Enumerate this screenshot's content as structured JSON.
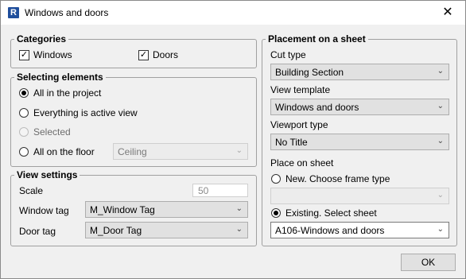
{
  "window": {
    "title": "Windows and doors",
    "close_glyph": "✕",
    "app_icon_letter": "R"
  },
  "categories": {
    "legend": "Categories",
    "windows": {
      "label": "Windows",
      "checked": true
    },
    "doors": {
      "label": "Doors",
      "checked": true
    },
    "check_glyph": "✓"
  },
  "selecting": {
    "legend": "Selecting elements",
    "all_project": "All in the project",
    "everything_view": "Everything is active view",
    "selected": "Selected",
    "all_floor": "All on the floor",
    "floor_value": "Ceiling"
  },
  "view_settings": {
    "legend": "View settings",
    "scale_label": "Scale",
    "scale_value": "50",
    "window_tag_label": "Window tag",
    "window_tag_value": "M_Window Tag",
    "door_tag_label": "Door tag",
    "door_tag_value": "M_Door Tag"
  },
  "placement": {
    "legend": "Placement on a sheet",
    "cut_type_label": "Cut type",
    "cut_type_value": "Building Section",
    "view_template_label": "View template",
    "view_template_value": "Windows and doors",
    "viewport_type_label": "Viewport type",
    "viewport_type_value": "No Title",
    "place_label": "Place on sheet",
    "new_frame_label": "New. Choose frame type",
    "new_frame_value": "",
    "existing_label": "Existing. Select sheet",
    "existing_value": "A106-Windows and doors"
  },
  "arrow_glyph": "⌄",
  "ok_label": "OK"
}
